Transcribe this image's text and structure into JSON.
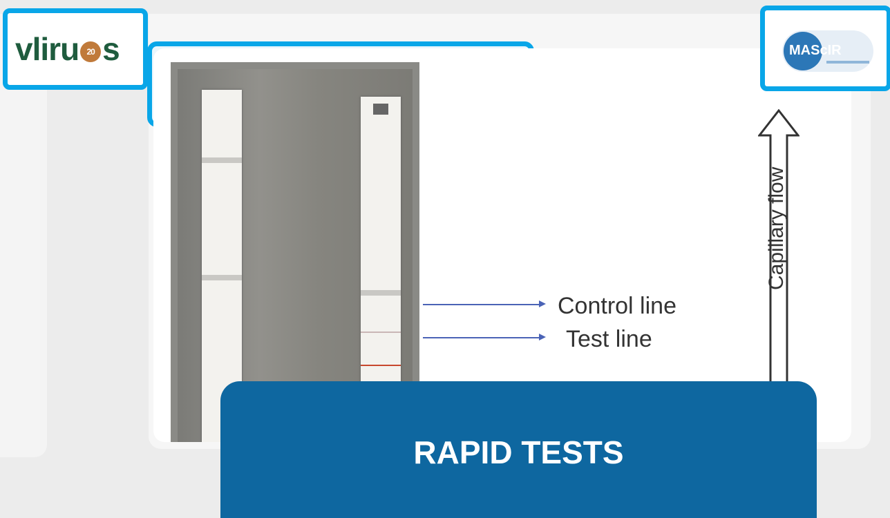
{
  "slide": {
    "title": "RAPID TESTS"
  },
  "logos": {
    "left": {
      "text_v": "vl",
      "text_i": "i",
      "text_r": "r",
      "text_u": "u",
      "badge": "20",
      "text_s": "s"
    },
    "right": {
      "text": "MAScIR"
    }
  },
  "figure": {
    "control_label": "Control line",
    "test_label": "Test line",
    "flow_label": "Capillary flow"
  },
  "colors": {
    "frame_accent": "#09a6e8",
    "title_bg": "#0e67a0",
    "arrow": "#4a63b6",
    "test_line": "#c7482d"
  }
}
